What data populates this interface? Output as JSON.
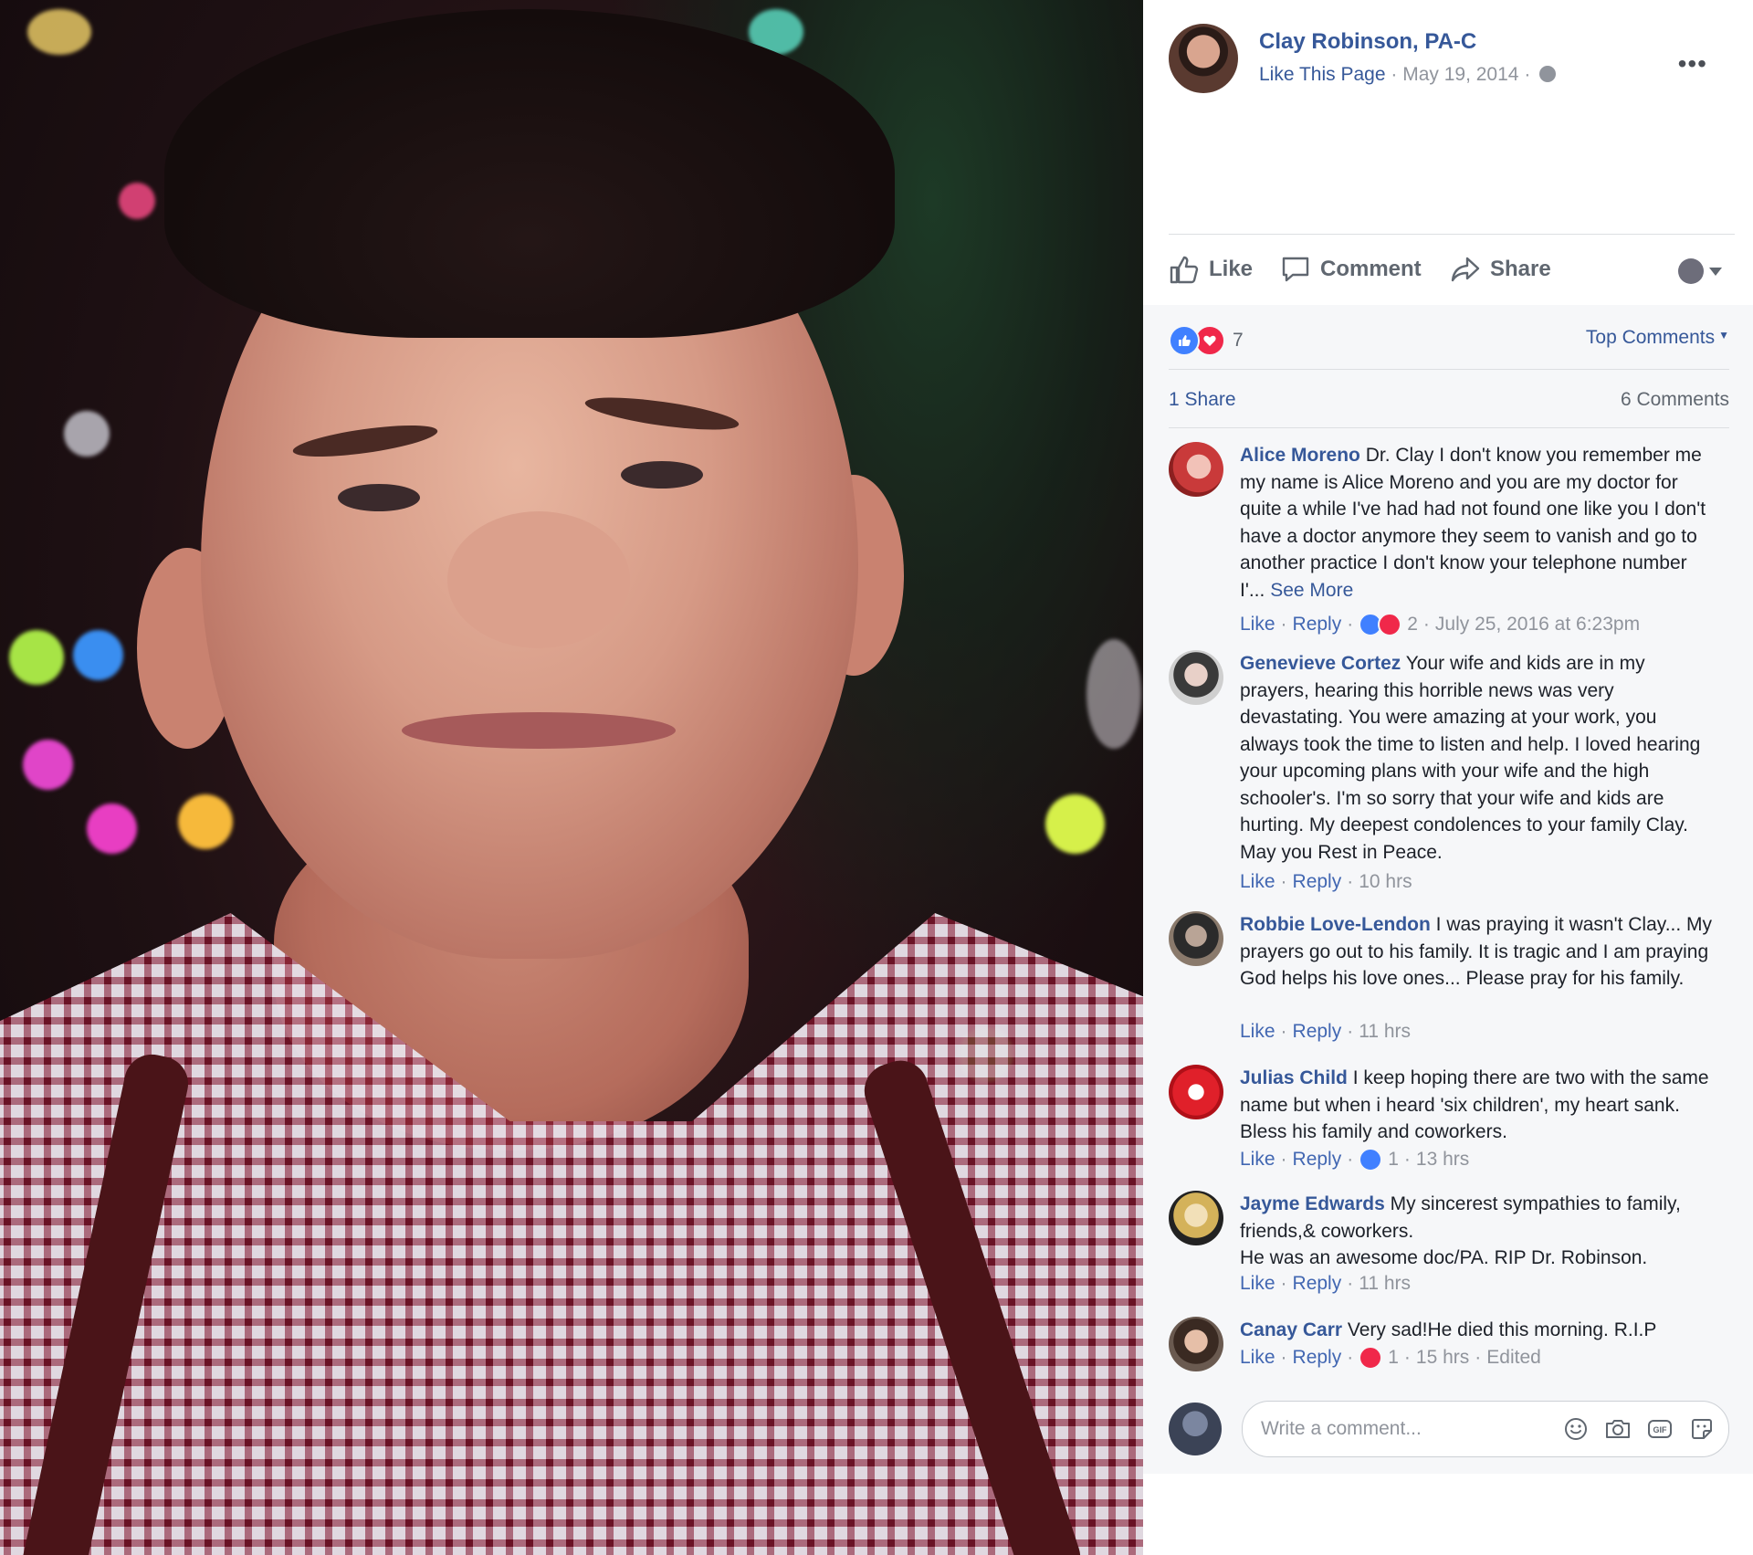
{
  "post": {
    "page_name": "Clay Robinson, PA-C",
    "like_page": "Like This Page",
    "date": "May 19, 2014",
    "separator": "·"
  },
  "actions": {
    "like": "Like",
    "comment": "Comment",
    "share": "Share"
  },
  "stats": {
    "reactions_count": "7",
    "sort_label": "Top Comments",
    "shares": "1 Share",
    "comments": "6 Comments"
  },
  "comments": [
    {
      "author": "Alice Moreno",
      "text": "Dr. Clay I don't know you remember me my name is Alice Moreno and you are my doctor for quite a while I've had had not found one like you I don't have a doctor anymore they seem to vanish and go to another practice I don't know your telephone number I'...",
      "see_more": "See More",
      "like": "Like",
      "reply": "Reply",
      "reactions": "2",
      "time": "July 25, 2016 at 6:23pm"
    },
    {
      "author": "Genevieve Cortez",
      "text": "Your wife and kids are in my prayers, hearing this horrible news was very devastating. You were amazing at your work, you always took the time to listen and help. I loved hearing your upcoming plans with your wife and the high schooler's. I'm so sorry that your wife and kids are hurting. My deepest condolences to your family Clay. May you Rest in Peace.",
      "like": "Like",
      "reply": "Reply",
      "time": "10 hrs"
    },
    {
      "author": "Robbie Love-Lendon",
      "text": "I was praying it wasn't Clay... My prayers go out to his family. It is tragic and I am praying God helps his love ones... Please pray for his family.",
      "like": "Like",
      "reply": "Reply",
      "time": "11 hrs"
    },
    {
      "author": "Julias Child",
      "text": "I keep hoping there are two with the same name but when i heard 'six children', my heart sank. Bless his family and coworkers.",
      "like": "Like",
      "reply": "Reply",
      "reactions": "1",
      "time": "13 hrs"
    },
    {
      "author": "Jayme Edwards",
      "text": "My sincerest sympathies to family, friends,& coworkers.",
      "text2": "He was an awesome doc/PA. RIP Dr. Robinson.",
      "like": "Like",
      "reply": "Reply",
      "time": "11 hrs"
    },
    {
      "author": "Canay Carr",
      "text": "Very sad!He died this morning. R.I.P",
      "like": "Like",
      "reply": "Reply",
      "reactions": "1",
      "time": "15 hrs",
      "edited": "Edited"
    }
  ],
  "composer": {
    "placeholder": "Write a comment..."
  },
  "colors": {
    "link": "#365899",
    "like_blue": "#4080ff",
    "love_red": "#f0284a",
    "muted": "#90949c"
  },
  "icons": [
    "more-icon",
    "globe-icon",
    "like-icon",
    "comment-icon",
    "share-icon",
    "emoji-icon",
    "camera-icon",
    "gif-icon",
    "sticker-icon"
  ]
}
